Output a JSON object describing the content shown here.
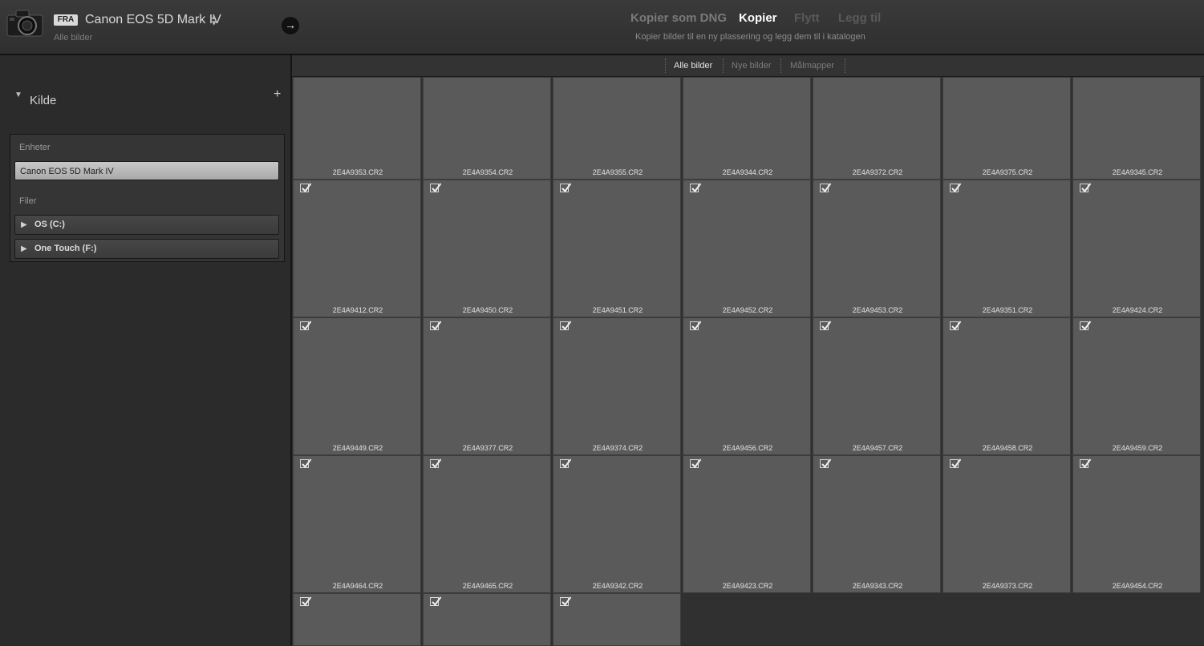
{
  "header": {
    "source_badge": "FRA",
    "source_device": "Canon EOS 5D Mark IV",
    "source_subtitle": "Alle bilder",
    "go_icon": "→",
    "modes": [
      {
        "label": "Kopier som DNG",
        "active": false,
        "color": "#7a7a7a"
      },
      {
        "label": "Kopier",
        "active": true,
        "color": "#ffffff"
      },
      {
        "label": "Flytt",
        "active": false,
        "color": "#5a5a5a"
      },
      {
        "label": "Legg til",
        "active": false,
        "color": "#5a5a5a"
      }
    ],
    "mode_description": "Kopier bilder til en ny plassering og legg dem til i katalogen"
  },
  "left_panel": {
    "section_title": "Kilde",
    "add_icon": "+",
    "devices_label": "Enheter",
    "device_button": "Canon EOS 5D Mark IV",
    "files_label": "Filer",
    "drives": [
      {
        "label": "OS (C:)"
      },
      {
        "label": "One Touch (F:)"
      }
    ]
  },
  "grid": {
    "filters": [
      {
        "label": "Alle bilder",
        "active": true
      },
      {
        "label": "Nye bilder",
        "active": false
      },
      {
        "label": "Målmapper",
        "active": false
      }
    ],
    "thumbnails": [
      {
        "filename": "2E4A9353.CR2",
        "checked": false
      },
      {
        "filename": "2E4A9354.CR2",
        "checked": false
      },
      {
        "filename": "2E4A9355.CR2",
        "checked": false
      },
      {
        "filename": "2E4A9344.CR2",
        "checked": false
      },
      {
        "filename": "2E4A9372.CR2",
        "checked": false
      },
      {
        "filename": "2E4A9375.CR2",
        "checked": false
      },
      {
        "filename": "2E4A9345.CR2",
        "checked": false
      },
      {
        "filename": "2E4A9412.CR2",
        "checked": true
      },
      {
        "filename": "2E4A9450.CR2",
        "checked": true
      },
      {
        "filename": "2E4A9451.CR2",
        "checked": true
      },
      {
        "filename": "2E4A9452.CR2",
        "checked": true
      },
      {
        "filename": "2E4A9453.CR2",
        "checked": true
      },
      {
        "filename": "2E4A9351.CR2",
        "checked": true
      },
      {
        "filename": "2E4A9424.CR2",
        "checked": true
      },
      {
        "filename": "2E4A9449.CR2",
        "checked": true
      },
      {
        "filename": "2E4A9377.CR2",
        "checked": true
      },
      {
        "filename": "2E4A9374.CR2",
        "checked": true
      },
      {
        "filename": "2E4A9456.CR2",
        "checked": true
      },
      {
        "filename": "2E4A9457.CR2",
        "checked": true
      },
      {
        "filename": "2E4A9458.CR2",
        "checked": true
      },
      {
        "filename": "2E4A9459.CR2",
        "checked": true
      },
      {
        "filename": "2E4A9464.CR2",
        "checked": true
      },
      {
        "filename": "2E4A9465.CR2",
        "checked": true
      },
      {
        "filename": "2E4A9342.CR2",
        "checked": true
      },
      {
        "filename": "2E4A9423.CR2",
        "checked": true
      },
      {
        "filename": "2E4A9343.CR2",
        "checked": true
      },
      {
        "filename": "2E4A9373.CR2",
        "checked": true
      },
      {
        "filename": "2E4A9454.CR2",
        "checked": true
      },
      {
        "filename": "",
        "checked": true
      },
      {
        "filename": "",
        "checked": true
      },
      {
        "filename": "",
        "checked": true
      }
    ]
  }
}
